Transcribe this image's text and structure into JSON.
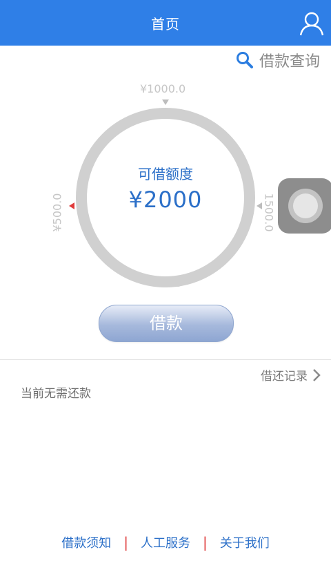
{
  "header": {
    "title": "首页"
  },
  "search": {
    "label": "借款查询"
  },
  "dial": {
    "tick_top": "¥1000.0",
    "tick_left": "¥500.0",
    "tick_right": "1500.0",
    "label": "可借额度",
    "amount": "¥2000"
  },
  "borrow_button": {
    "label": "借款"
  },
  "records": {
    "link_label": "借还记录",
    "status": "当前无需还款"
  },
  "footer": {
    "links": [
      "借款须知",
      "人工服务",
      "关于我们"
    ],
    "separator": "|"
  },
  "colors": {
    "header_bg": "#2f7fe7",
    "accent_text": "#2b6fc8",
    "separator": "#e04040"
  }
}
